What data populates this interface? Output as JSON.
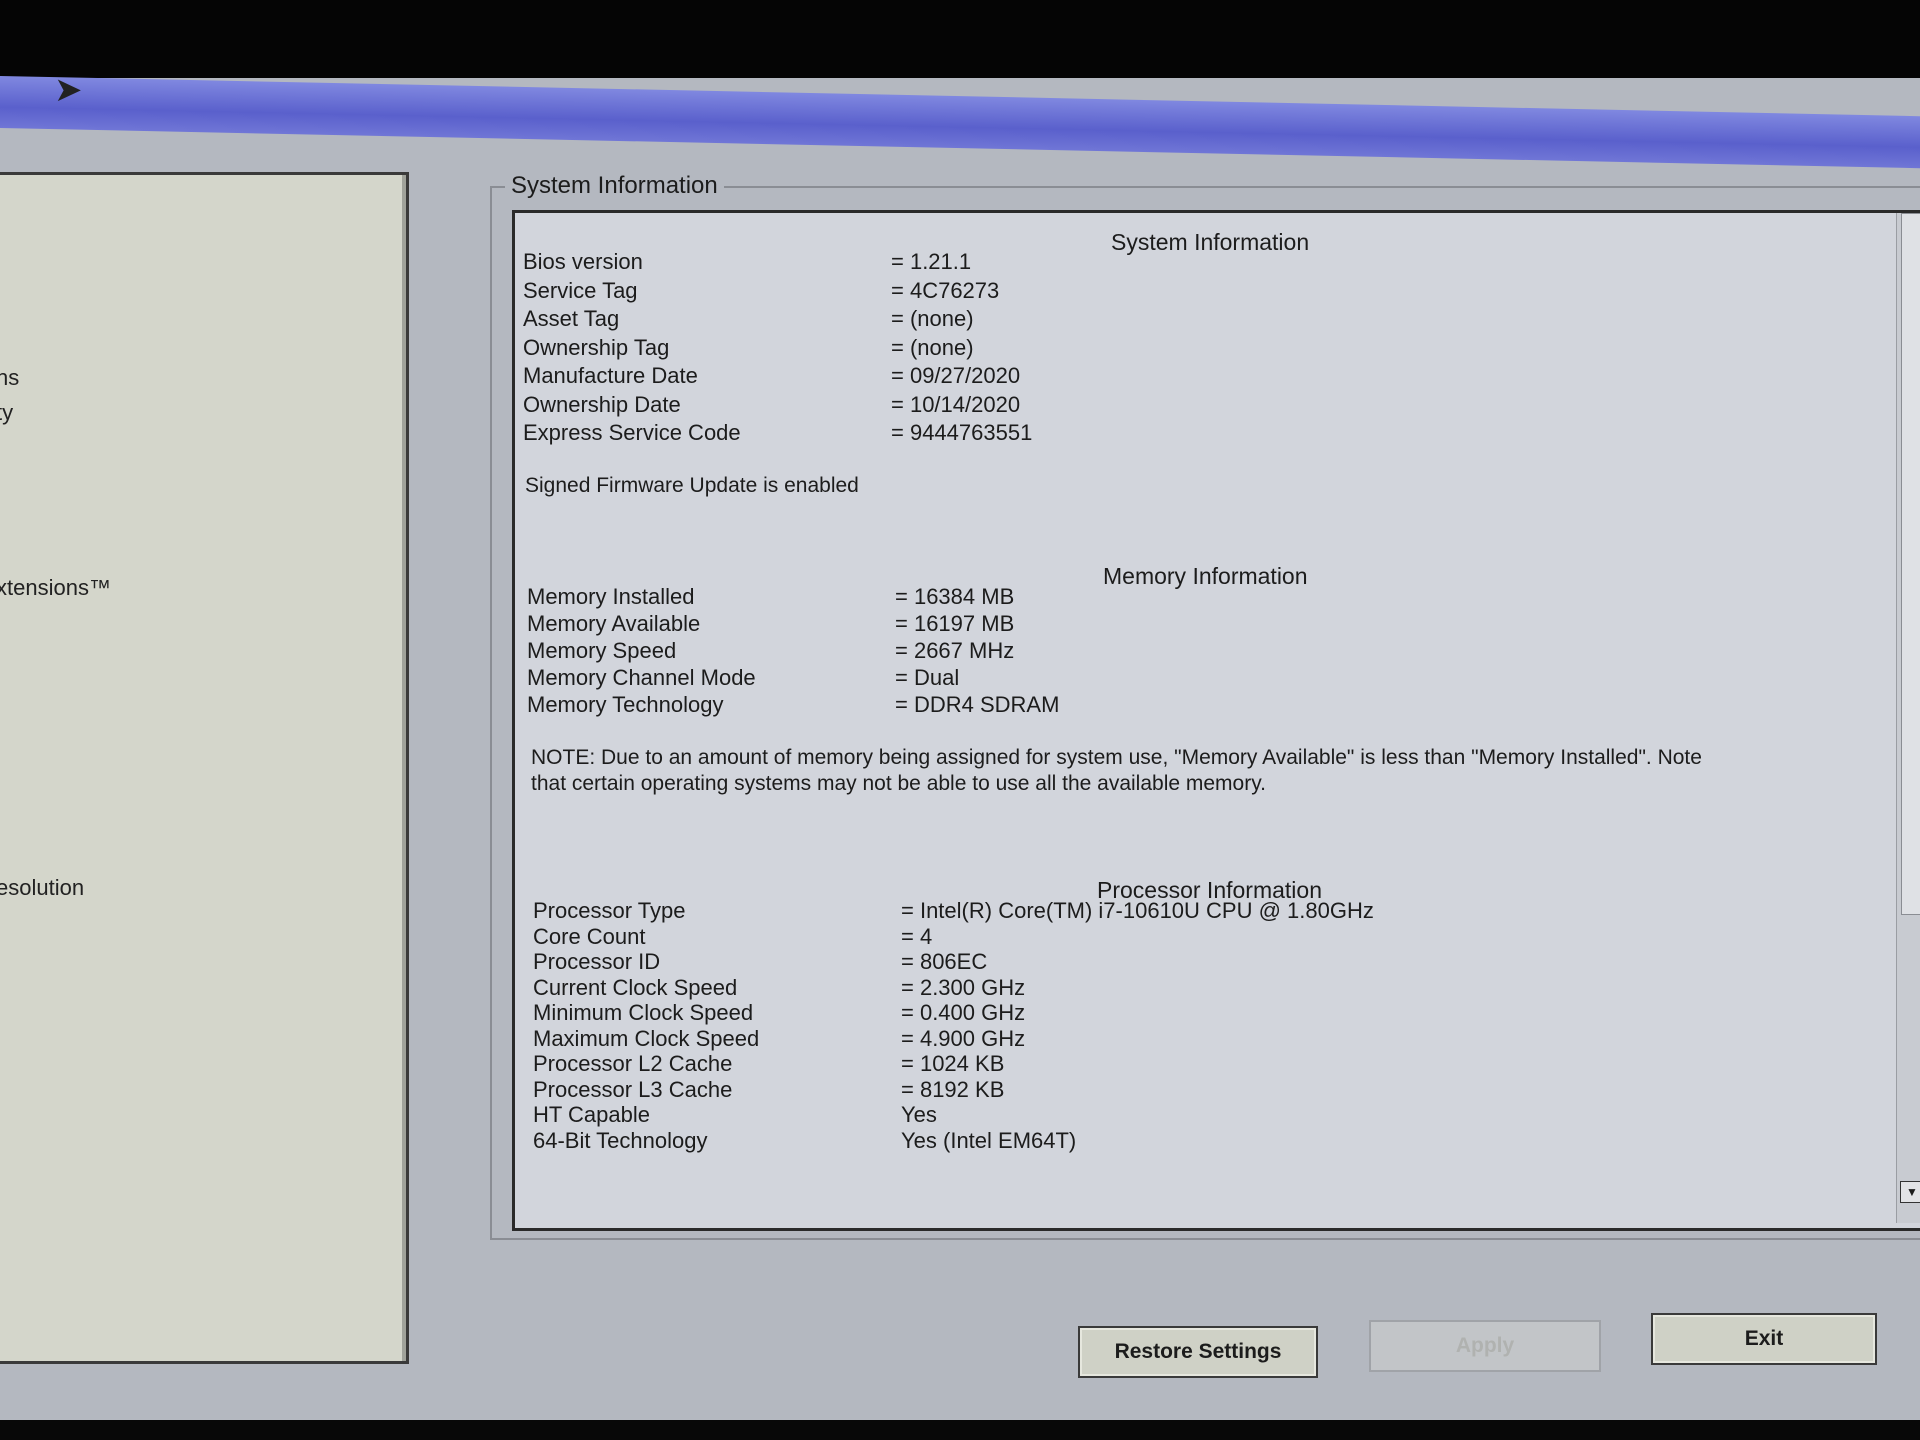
{
  "left_menu": {
    "items": [
      "ns",
      "ty",
      "xtensions™",
      "esolution"
    ]
  },
  "group_title": "System Information",
  "system": {
    "title": "System Information",
    "rows": [
      {
        "label": "Bios version",
        "value": "= 1.21.1"
      },
      {
        "label": "Service Tag",
        "value": "= 4C76273"
      },
      {
        "label": "Asset Tag",
        "value": "= (none)"
      },
      {
        "label": "Ownership Tag",
        "value": "= (none)"
      },
      {
        "label": "Manufacture Date",
        "value": "= 09/27/2020"
      },
      {
        "label": "Ownership Date",
        "value": "= 10/14/2020"
      },
      {
        "label": "Express Service Code",
        "value": "= 9444763551"
      }
    ],
    "firmware_note": "Signed Firmware Update is enabled"
  },
  "memory": {
    "title": "Memory Information",
    "rows": [
      {
        "label": "Memory Installed",
        "value": "= 16384 MB"
      },
      {
        "label": "Memory Available",
        "value": "= 16197 MB"
      },
      {
        "label": "Memory Speed",
        "value": "= 2667 MHz"
      },
      {
        "label": "Memory Channel Mode",
        "value": "= Dual"
      },
      {
        "label": "Memory Technology",
        "value": "= DDR4 SDRAM"
      }
    ],
    "note": "NOTE: Due to an amount of memory being assigned for system use, \"Memory Available\" is less than \"Memory Installed\". Note that certain operating systems may not be able to use all the available memory."
  },
  "processor": {
    "title": "Processor Information",
    "rows": [
      {
        "label": "Processor Type",
        "value": "= Intel(R) Core(TM) i7-10610U CPU @ 1.80GHz"
      },
      {
        "label": "Core Count",
        "value": "= 4"
      },
      {
        "label": "Processor ID",
        "value": "= 806EC"
      },
      {
        "label": "Current Clock Speed",
        "value": "= 2.300 GHz"
      },
      {
        "label": "Minimum Clock Speed",
        "value": "= 0.400 GHz"
      },
      {
        "label": "Maximum Clock Speed",
        "value": "= 4.900 GHz"
      },
      {
        "label": "Processor L2 Cache",
        "value": "= 1024 KB"
      },
      {
        "label": "Processor L3 Cache",
        "value": "= 8192 KB"
      },
      {
        "label": "HT Capable",
        "value": "Yes"
      },
      {
        "label": "64-Bit Technology",
        "value": "Yes (Intel EM64T)"
      }
    ]
  },
  "buttons": {
    "restore": "Restore Settings",
    "apply": "Apply",
    "exit": "Exit"
  },
  "icons": {
    "cursor": "mouse-pointer-icon",
    "scroll_down": "chevron-down-icon"
  },
  "colors": {
    "titlebar": "#5a60cc",
    "panel": "#d2d5dc",
    "background": "#b4b8c0"
  }
}
